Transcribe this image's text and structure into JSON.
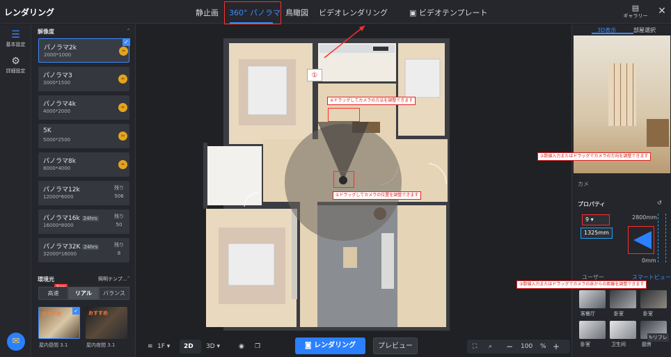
{
  "app": {
    "title": "レンダリング"
  },
  "tabs": [
    {
      "label": "静止画",
      "active": false
    },
    {
      "label": "360° パノラマ",
      "active": true
    },
    {
      "label": "鳥瞰図",
      "active": false
    },
    {
      "label": "ビデオレンダリング",
      "active": false
    },
    {
      "label": "ビデオテンプレート",
      "active": false
    }
  ],
  "header": {
    "gallery_label": "ギャラリー",
    "close_glyph": "✕"
  },
  "rail": [
    {
      "label": "基本設定",
      "icon": "sliders-icon",
      "glyph": "☰"
    },
    {
      "label": "詳細設定",
      "icon": "gear-icon",
      "glyph": "⚙"
    }
  ],
  "resolution": {
    "title": "解像度",
    "items": [
      {
        "name": "パノラマ2k",
        "size": "2000*1000",
        "coin": "∞",
        "selected": true
      },
      {
        "name": "パノラマ3",
        "size": "3000*1500",
        "coin": "∞"
      },
      {
        "name": "パノラマ4k",
        "size": "4000*2000",
        "coin": "∞"
      },
      {
        "name": "5K",
        "size": "5000*2500",
        "coin": "∞"
      },
      {
        "name": "パノラマ8k",
        "size": "8000*4000",
        "coin": "∞"
      },
      {
        "name": "パノラマ12k",
        "size": "12000*6000",
        "remaining_label": "残り",
        "remaining": "506"
      },
      {
        "name": "パノラマ16k",
        "badge": "24hrs",
        "size": "16000*8000",
        "remaining_label": "残り",
        "remaining": "50"
      },
      {
        "name": "パノラマ32K",
        "badge": "24hrs",
        "size": "32000*16000",
        "remaining_label": "残り",
        "remaining": "8"
      }
    ]
  },
  "lighting": {
    "title": "環境光",
    "template_label": "照明テンプ...",
    "new_tag": "New",
    "modes": [
      "高速",
      "リアル",
      "バランス"
    ],
    "thumbs": [
      {
        "tag": "おすすめ",
        "caption": "屋内昼間 3.1",
        "selected": true
      },
      {
        "tag": "おすすめ",
        "caption": "屋内夜間 3.1",
        "selected": false
      }
    ]
  },
  "canvas": {
    "marker": "①",
    "annotations": {
      "direction": "④ドラッグしてカメラの方法を調整できます",
      "position": "①ドラッグしてカメラの位置を調整できます"
    }
  },
  "bottombar": {
    "floor": "1F",
    "view2d": "2D",
    "view3d": "3D",
    "render": "レンダリング",
    "preview": "プレビュー",
    "zoom": "100",
    "zoom_unit": "%",
    "minus": "−",
    "plus": "+"
  },
  "right": {
    "tabs": [
      "3D表示",
      "部屋選択"
    ],
    "camera_label": "カメ",
    "properties_title": "プロパティ",
    "fov_value": "9",
    "height_value": "1325mm",
    "top_dim": "2800mm",
    "bottom_dim": "0mm",
    "annotation_direction": "②数値入力またはドラッグでカメラの方向を調整できます",
    "annotation_height": "③数値入力またはドラッグでカメラの床からの距離を調整できます",
    "user_tab": "ユーザー",
    "smart_tab": "スマートビュー",
    "rooms": [
      "客餐厅",
      "卧室",
      "卧室",
      "卧室",
      "卫生间",
      "厨房"
    ],
    "refresh_label": "リフレ"
  },
  "colors": {
    "accent": "#3d8bff",
    "annot": "#ff2d2d",
    "annot_blue": "#1ea7ff"
  }
}
